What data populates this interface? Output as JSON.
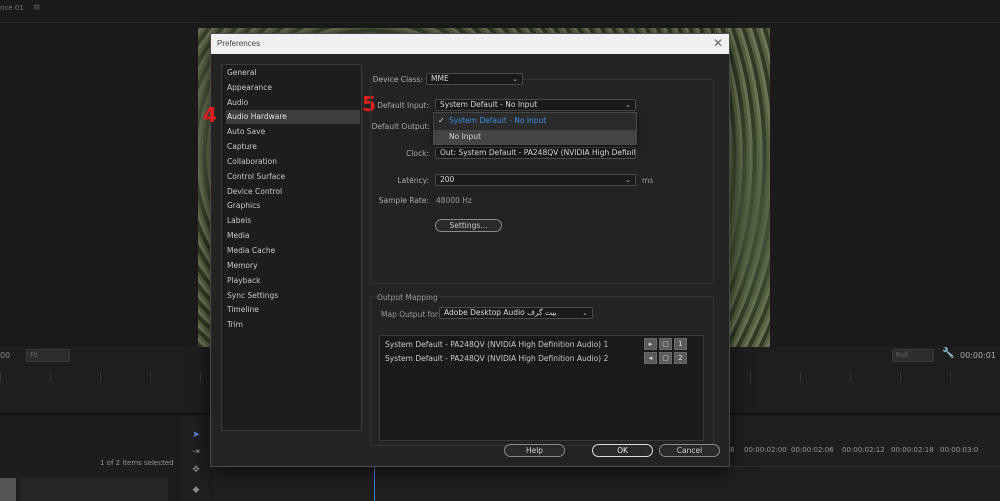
{
  "app": {
    "tab_title": "nce 01",
    "tab_menu_icon": "hamburger-icon",
    "timecode_left": "00",
    "fit_left": "Fit",
    "fit_right": "Full",
    "timecode_right": "00:00:01",
    "items_selected": "1 of 2 items selected",
    "sequence_times": [
      "8",
      "00:00:02:00",
      "00:00:02:06",
      "00:00:02:12",
      "00:00:02:18",
      "00:00:03:0"
    ]
  },
  "dialog": {
    "title": "Preferences",
    "categories": [
      {
        "label": "General"
      },
      {
        "label": "Appearance"
      },
      {
        "label": "Audio"
      },
      {
        "label": "Audio Hardware",
        "selected": true
      },
      {
        "label": "Auto Save"
      },
      {
        "label": "Capture"
      },
      {
        "label": "Collaboration"
      },
      {
        "label": "Control Surface"
      },
      {
        "label": "Device Control"
      },
      {
        "label": "Graphics"
      },
      {
        "label": "Labels"
      },
      {
        "label": "Media"
      },
      {
        "label": "Media Cache"
      },
      {
        "label": "Memory"
      },
      {
        "label": "Playback"
      },
      {
        "label": "Sync Settings"
      },
      {
        "label": "Timeline"
      },
      {
        "label": "Trim"
      }
    ],
    "annotations": {
      "step4": "4",
      "step5": "5"
    },
    "device_class": {
      "label": "Device Class:",
      "value": "MME"
    },
    "default_input": {
      "label": "Default Input:",
      "value": "System Default - No Input"
    },
    "default_output": {
      "label": "Default Output:"
    },
    "input_menu": {
      "items": [
        {
          "label": "System Default - No Input",
          "checked": true
        },
        {
          "label": "No Input",
          "hovered": true
        }
      ]
    },
    "clock": {
      "label": "Clock:",
      "value": "Out: System Default - PA248QV (NVIDIA High Definit..."
    },
    "latency": {
      "label": "Latency:",
      "value": "200",
      "unit": "ms"
    },
    "sample_rate": {
      "label": "Sample Rate:",
      "value": "48000 Hz"
    },
    "settings_button": "Settings...",
    "output_mapping": {
      "heading": "Output Mapping",
      "map_output_label": "Map Output for:",
      "map_output_value": "Adobe Desktop Audio بیت گرف",
      "rows": [
        {
          "label": "System Default - PA248QV (NVIDIA High Definition Audio) 1",
          "channel": "1"
        },
        {
          "label": "System Default - PA248QV (NVIDIA High Definition Audio) 2",
          "channel": "2"
        }
      ]
    },
    "buttons": {
      "help": "Help",
      "ok": "OK",
      "cancel": "Cancel"
    }
  },
  "colors": {
    "accent": "#3f8fe0",
    "annotation": "#e11d1d",
    "dialog_bg": "#232323"
  }
}
